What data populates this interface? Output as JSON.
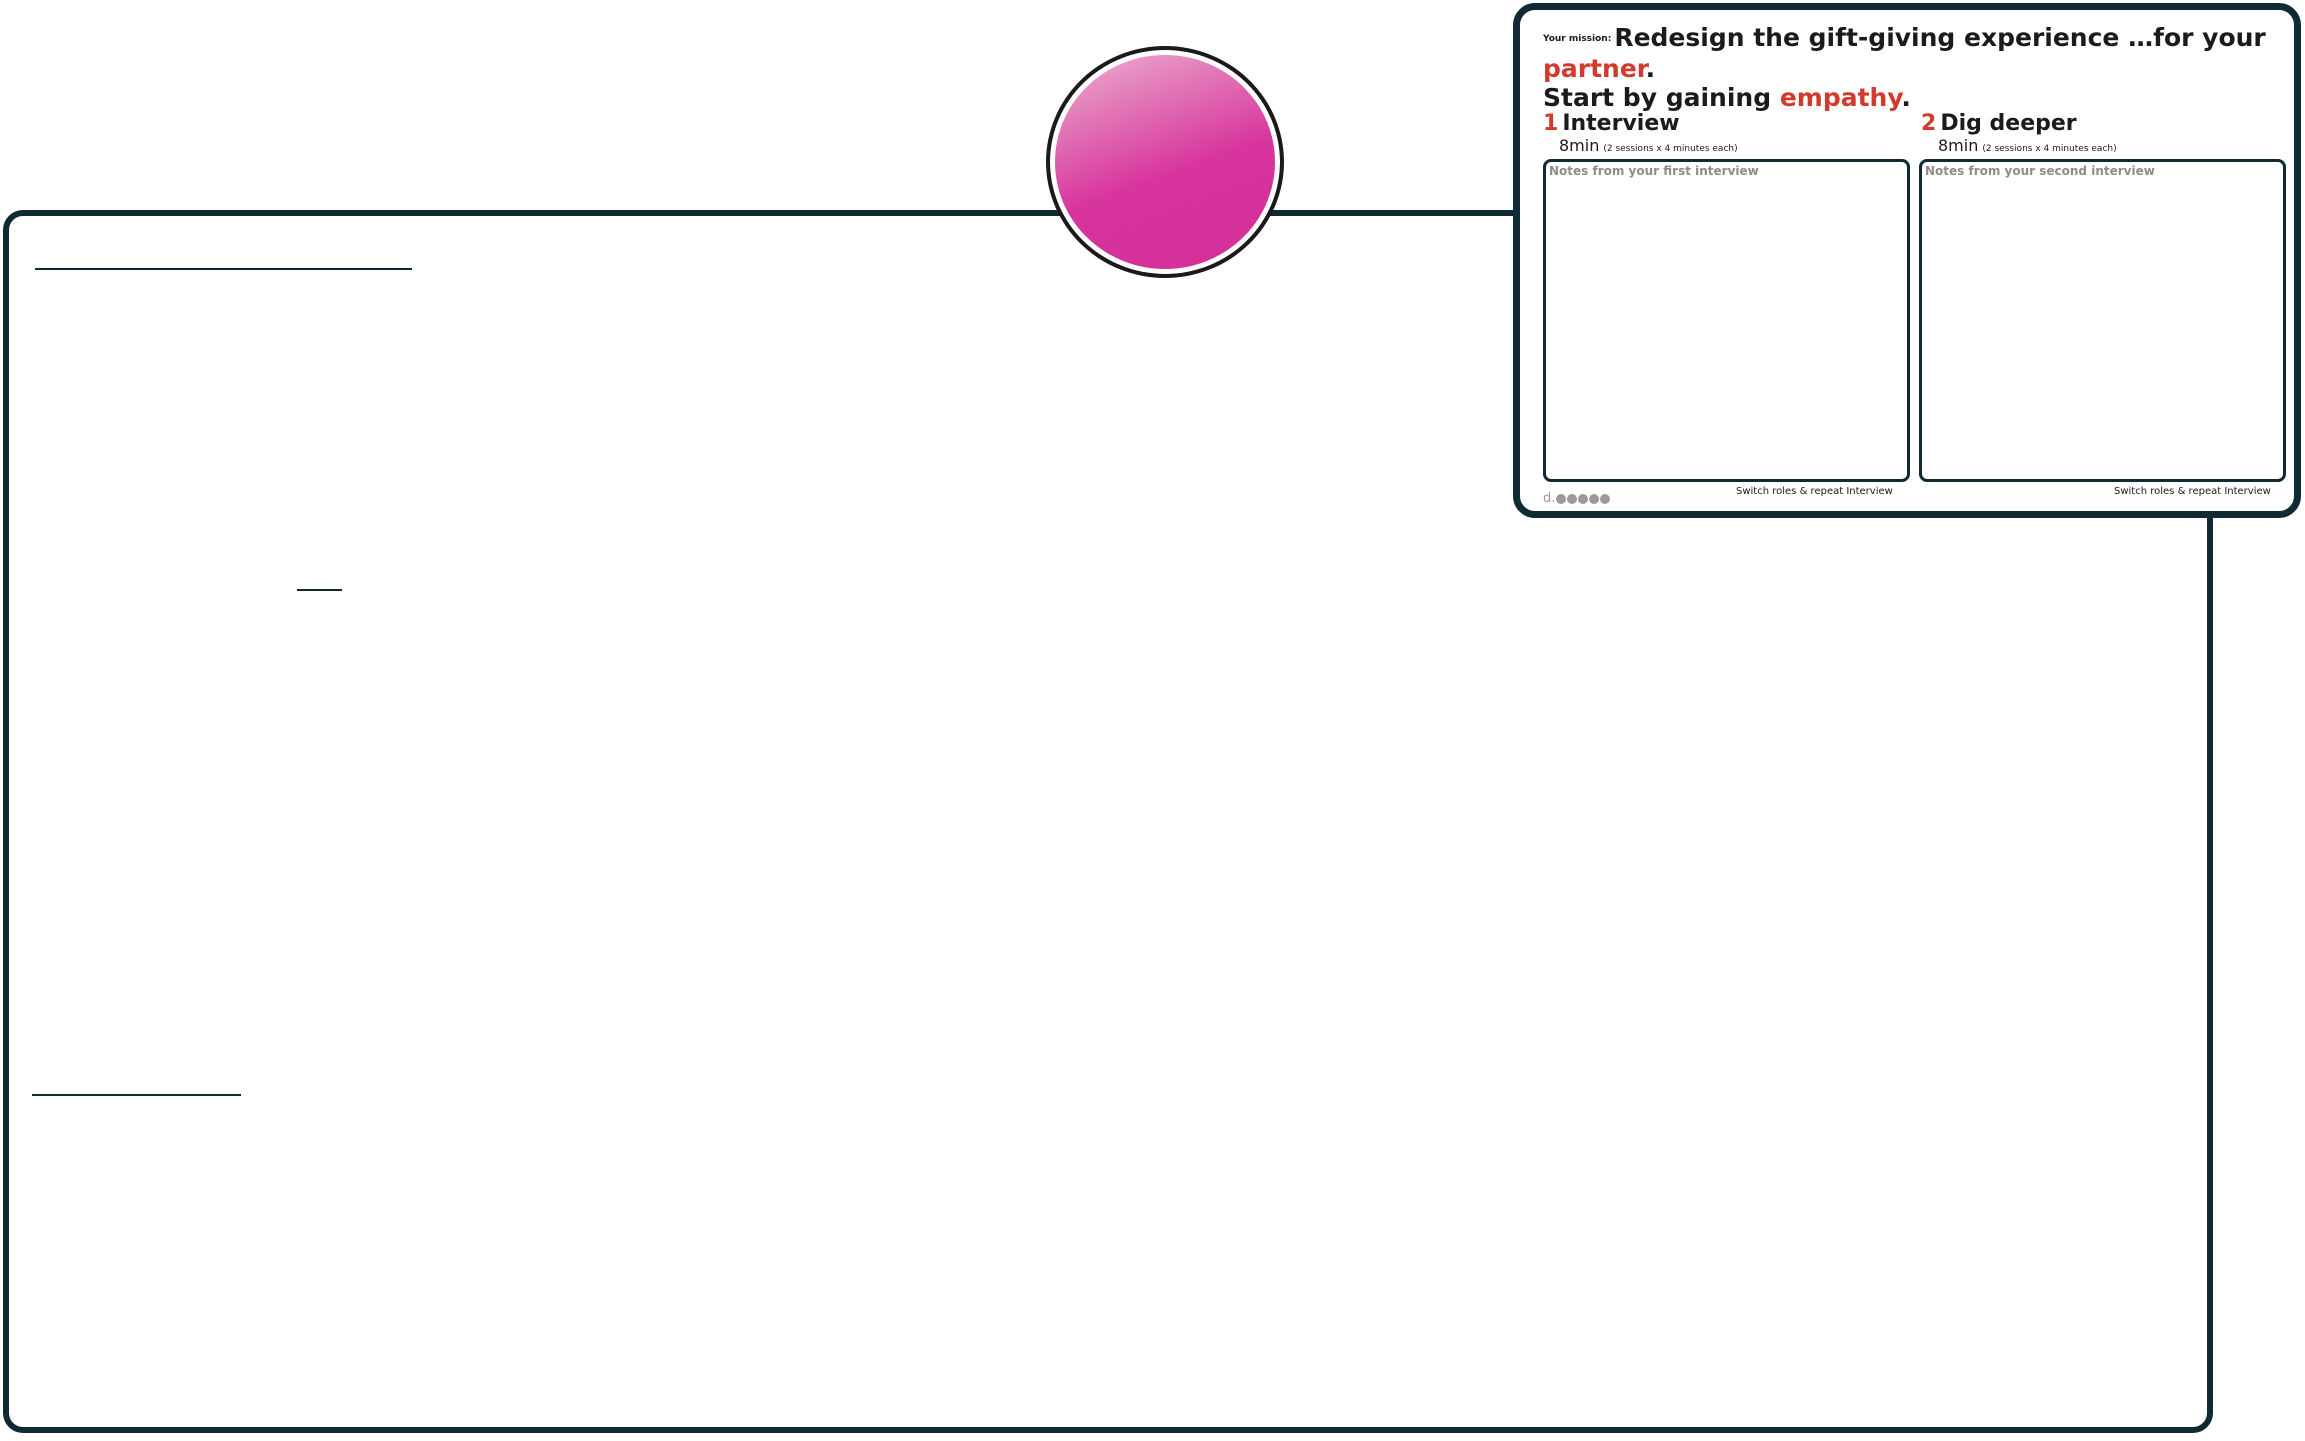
{
  "card": {
    "mission_prefix": "Your mission:",
    "mission_line1_a": "Redesign the gift-giving experience …for your ",
    "mission_line1_b": "partner",
    "mission_line1_c": ".",
    "mission_line2_a": "Start by gaining ",
    "mission_line2_b": "empathy",
    "mission_line2_c": ".",
    "steps": [
      {
        "number": "1",
        "title": "Interview",
        "duration": "8min",
        "duration_note": "(2 sessions x 4 minutes each)",
        "notes_label": "Notes from your first interview",
        "footer": "Switch roles & repeat Interview"
      },
      {
        "number": "2",
        "title": "Dig deeper",
        "duration": "8min",
        "duration_note": "(2 sessions x 4 minutes each)",
        "notes_label": "Notes from your second interview",
        "footer": "Switch roles & repeat Interview"
      }
    ],
    "logo_text": "d."
  },
  "colors": {
    "frame": "#0f2a32",
    "accent_red": "#d23a2c",
    "magnet_pink": "#d8349d"
  }
}
